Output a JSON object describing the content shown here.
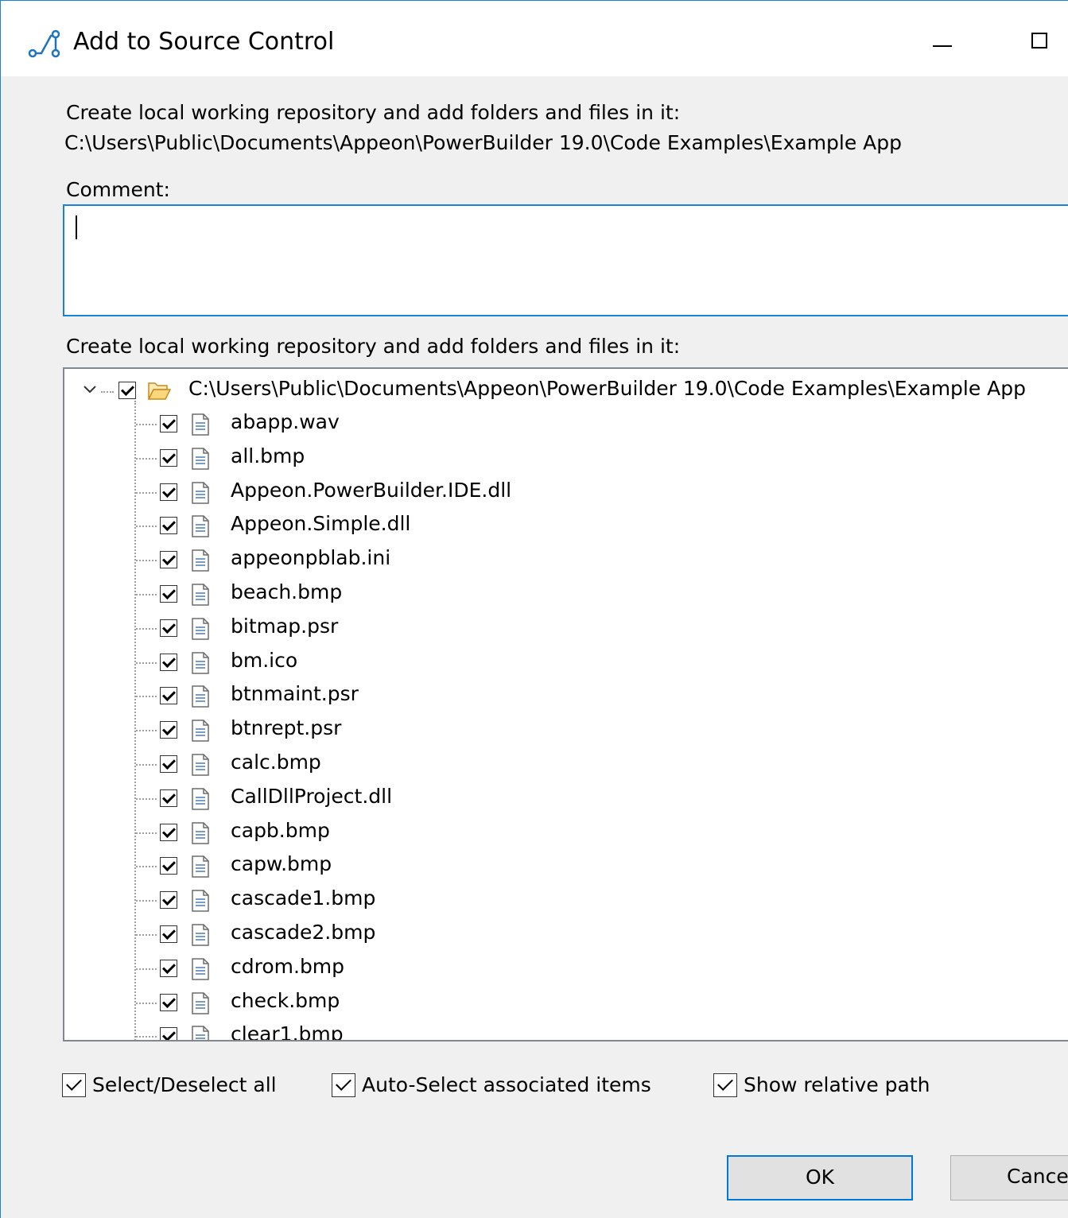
{
  "window": {
    "title": "Add to Source Control"
  },
  "header": {
    "description": "Create local working repository and add folders and files in it:",
    "path": "C:\\Users\\Public\\Documents\\Appeon\\PowerBuilder 19.0\\Code Examples\\Example App"
  },
  "comment": {
    "label": "Comment:",
    "value": ""
  },
  "tree": {
    "label": "Create local working repository and add folders and files in it:",
    "root": {
      "label": "C:\\Users\\Public\\Documents\\Appeon\\PowerBuilder 19.0\\Code Examples\\Example App",
      "checked": true,
      "expanded": true
    },
    "items": [
      {
        "label": "abapp.wav",
        "checked": true
      },
      {
        "label": "all.bmp",
        "checked": true
      },
      {
        "label": "Appeon.PowerBuilder.IDE.dll",
        "checked": true
      },
      {
        "label": "Appeon.Simple.dll",
        "checked": true
      },
      {
        "label": "appeonpblab.ini",
        "checked": true
      },
      {
        "label": "beach.bmp",
        "checked": true
      },
      {
        "label": "bitmap.psr",
        "checked": true
      },
      {
        "label": "bm.ico",
        "checked": true
      },
      {
        "label": "btnmaint.psr",
        "checked": true
      },
      {
        "label": "btnrept.psr",
        "checked": true
      },
      {
        "label": "calc.bmp",
        "checked": true
      },
      {
        "label": "CallDllProject.dll",
        "checked": true
      },
      {
        "label": "capb.bmp",
        "checked": true
      },
      {
        "label": "capw.bmp",
        "checked": true
      },
      {
        "label": "cascade1.bmp",
        "checked": true
      },
      {
        "label": "cascade2.bmp",
        "checked": true
      },
      {
        "label": "cdrom.bmp",
        "checked": true
      },
      {
        "label": "check.bmp",
        "checked": true
      },
      {
        "label": "clear1.bmp",
        "checked": true
      }
    ]
  },
  "options": {
    "select_all": {
      "label": "Select/Deselect all",
      "checked": true
    },
    "auto_select": {
      "label": "Auto-Select associated items",
      "checked": true
    },
    "relative_path": {
      "label": "Show relative path",
      "checked": true
    }
  },
  "buttons": {
    "ok": "OK",
    "cancel": "Cancel"
  },
  "colors": {
    "accent": "#0078d7",
    "dialog_bg": "#f0f0f0",
    "folder": "#e8a93b"
  }
}
